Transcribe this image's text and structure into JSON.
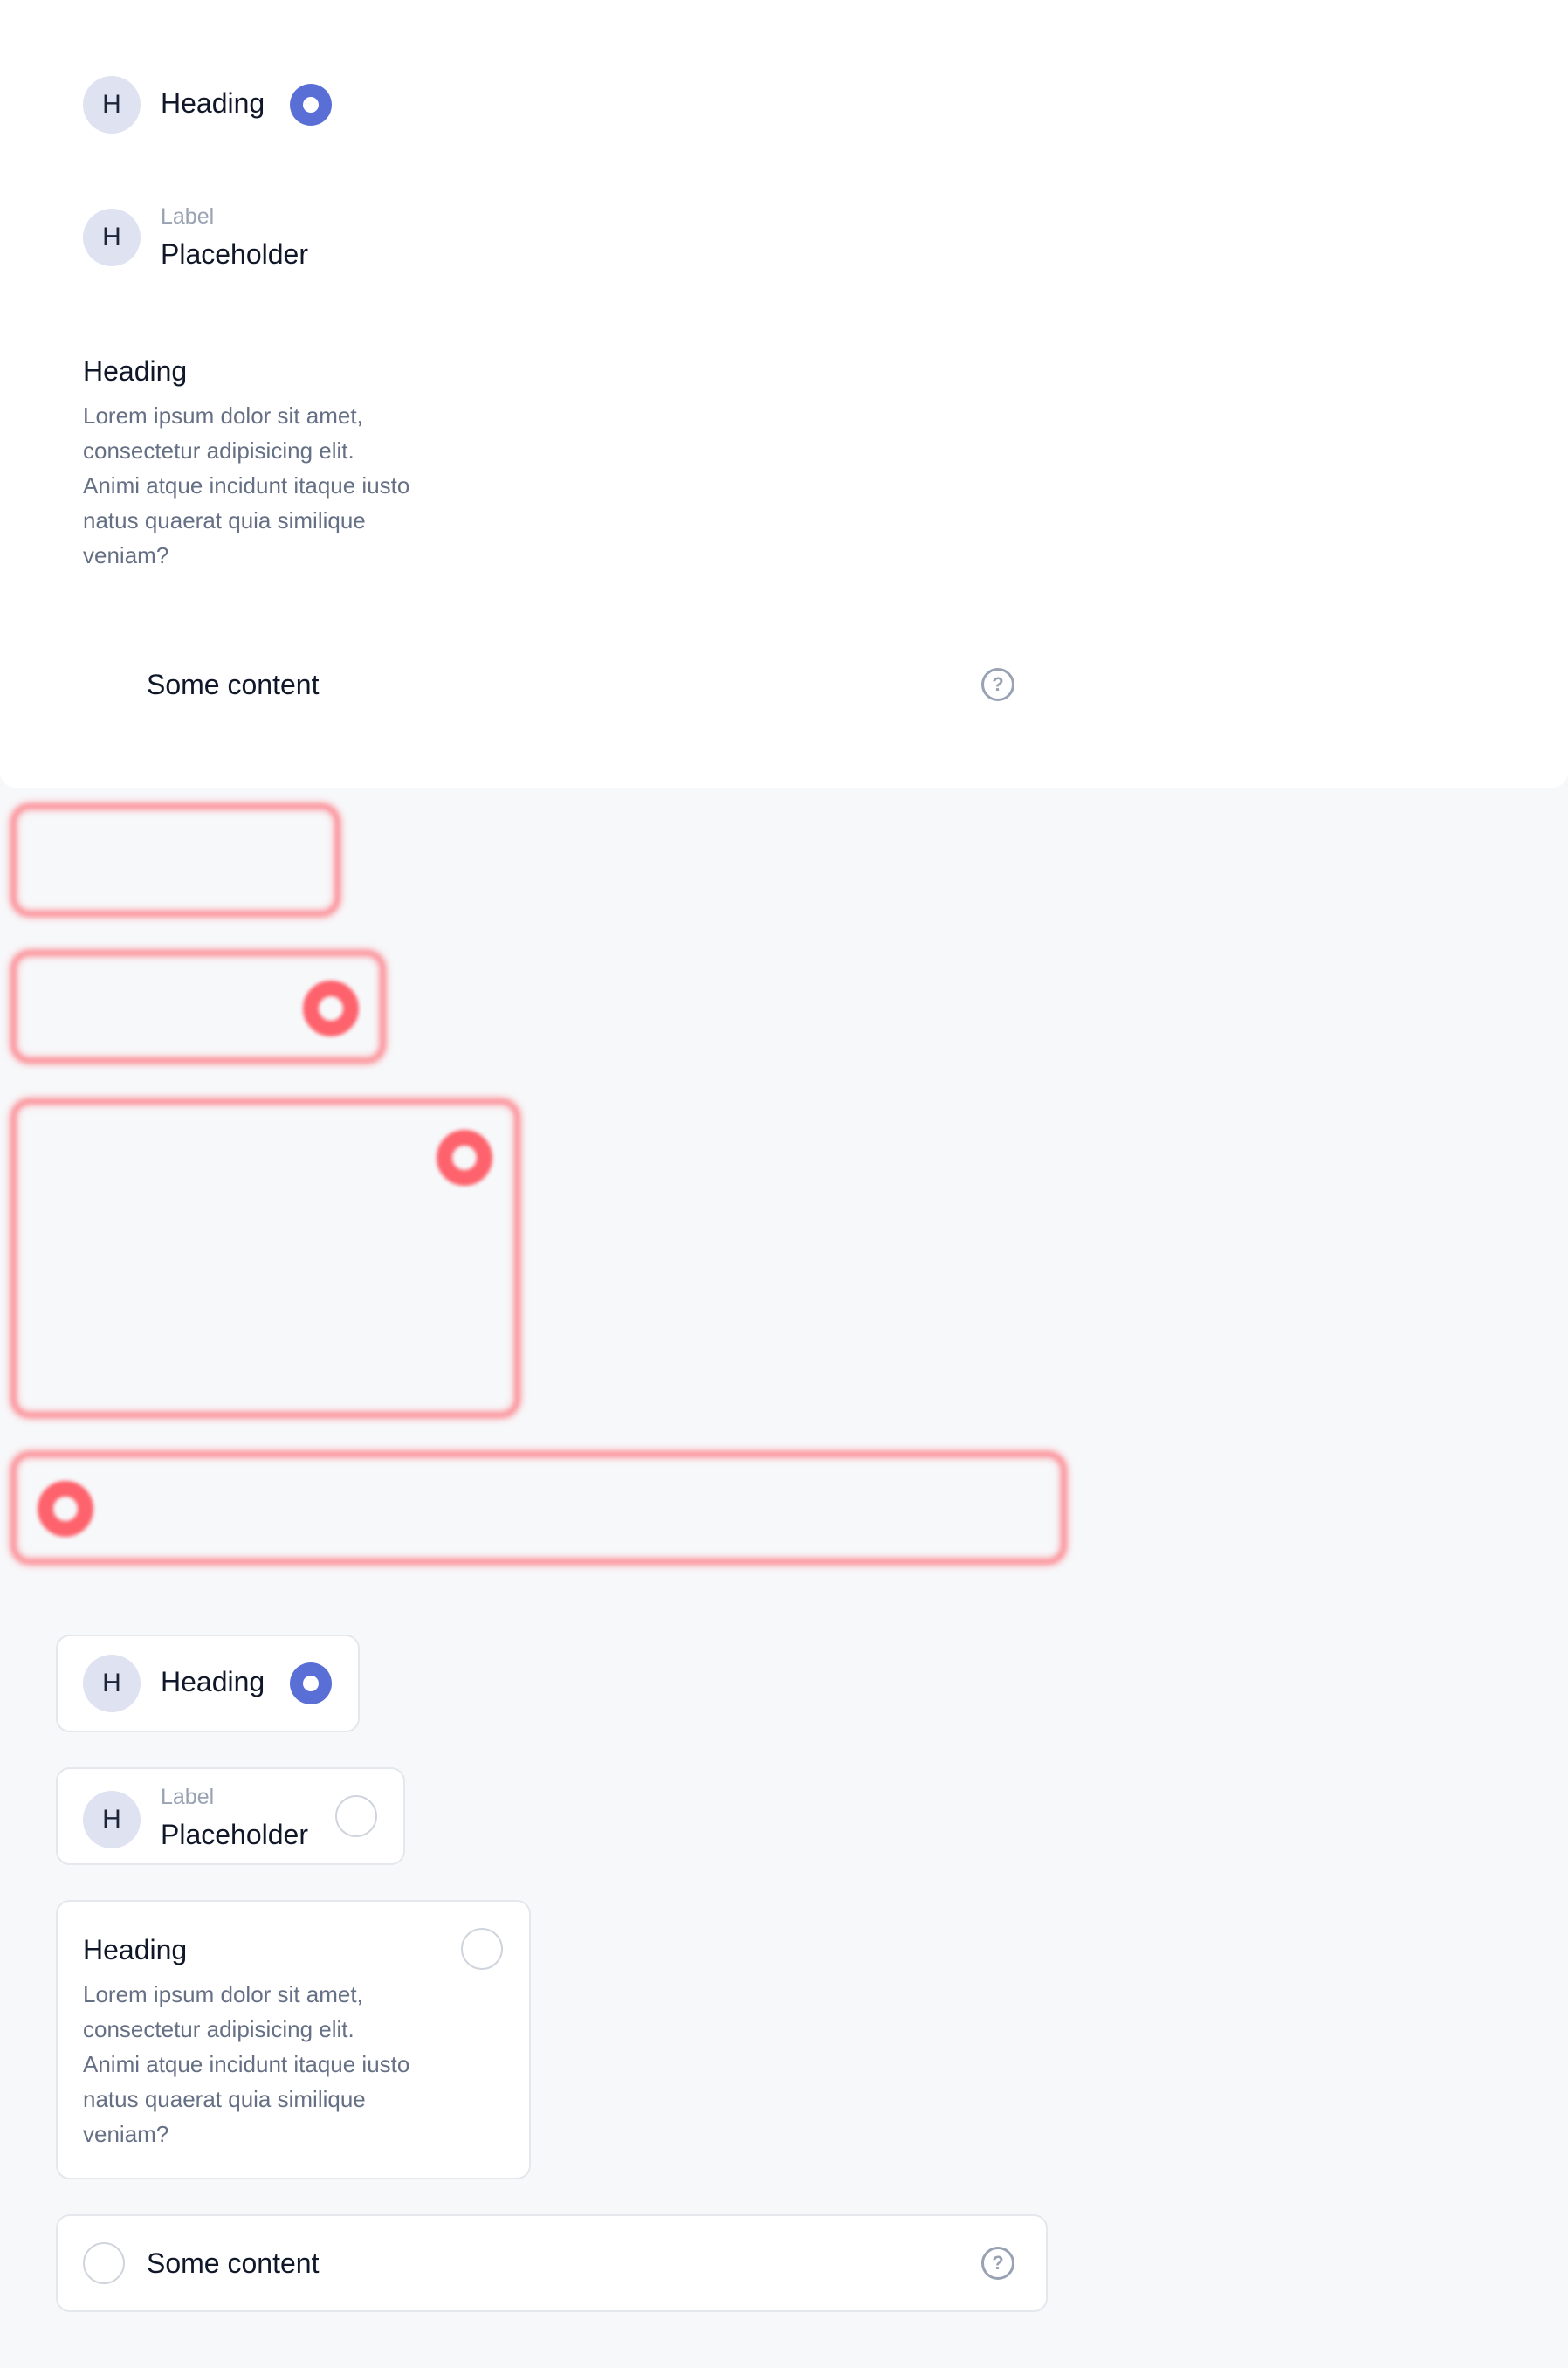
{
  "variants": {
    "plain": {
      "heading_item": {
        "avatar": "H",
        "heading": "Heading",
        "radio_state": "checked"
      },
      "label_item": {
        "avatar": "H",
        "label": "Label",
        "placeholder": "Placeholder"
      },
      "description_item": {
        "heading": "Heading",
        "body": "Lorem ipsum dolor sit amet, consectetur adipisicing elit. Animi atque incidunt itaque iusto natus quaerat quia similique veniam?"
      },
      "content_row": {
        "text": "Some content",
        "help_icon": "question-circle-icon"
      }
    },
    "carded": {
      "heading_item": {
        "avatar": "H",
        "heading": "Heading",
        "radio_state": "checked"
      },
      "label_item": {
        "avatar": "H",
        "label": "Label",
        "placeholder": "Placeholder",
        "radio_state": "unchecked"
      },
      "description_item": {
        "heading": "Heading",
        "body": "Lorem ipsum dolor sit amet, consectetur adipisicing elit. Animi atque incidunt itaque iusto natus quaerat quia similique veniam?",
        "radio_state": "unchecked"
      },
      "content_row": {
        "text": "Some content",
        "help_icon": "question-circle-icon",
        "radio_state": "unchecked"
      }
    }
  },
  "colors": {
    "accent": "#5a6fd6",
    "avatar_bg": "#dfe2f1",
    "focus_ring": "#ff4650",
    "muted_text": "#667085",
    "border": "#e4e7ec"
  }
}
